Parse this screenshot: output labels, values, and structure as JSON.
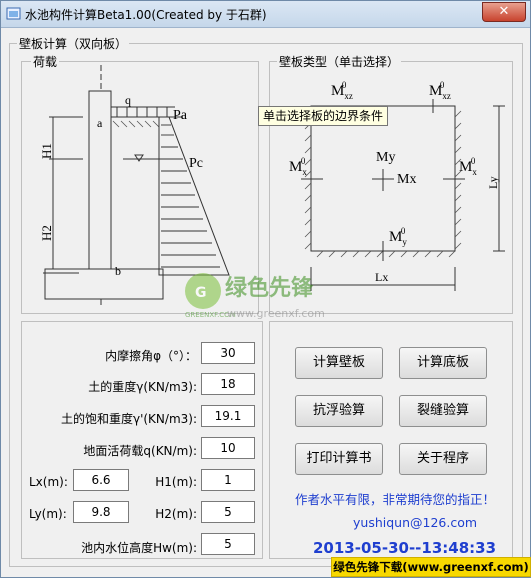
{
  "window": {
    "title": "水池构件计算Beta1.00(Created by 于石群)",
    "close_glyph": "✕"
  },
  "group_main": {
    "title": "壁板计算（双向板）"
  },
  "group_load": {
    "title": "荷载",
    "labels": {
      "q": "q",
      "a": "a",
      "b": "b",
      "Pa": "Pa",
      "Pc": "Pc",
      "H1": "H1",
      "H2": "H2"
    }
  },
  "group_type": {
    "title": "壁板类型（单击选择）",
    "labels": {
      "Mxz0_left": "M",
      "Mxz0_right": "M",
      "Mx0_left": "M",
      "Mx0_right": "M",
      "My": "My",
      "Mx": "Mx",
      "My0": "M",
      "Lx": "Lx",
      "Ly": "Ly",
      "sub_xz": "xz",
      "sub_x": "x",
      "sub_y": "y",
      "sup_0": "0"
    }
  },
  "tooltip": "单击选择板的边界条件",
  "inputs": {
    "phi": {
      "label": "内摩擦角φ（°）：",
      "value": "30"
    },
    "gamma": {
      "label": "土的重度γ(KN/m3):",
      "value": "18"
    },
    "gamma_sat": {
      "label": "土的饱和重度γ'(KN/m3):",
      "value": "19.1"
    },
    "q": {
      "label": "地面活荷载q(KN/m):",
      "value": "10"
    },
    "Lx": {
      "label": "Lx(m):",
      "value": "6.6"
    },
    "H1": {
      "label": "H1(m):",
      "value": "1"
    },
    "Ly": {
      "label": "Ly(m):",
      "value": "9.8"
    },
    "H2": {
      "label": "H2(m):",
      "value": "5"
    },
    "Hw": {
      "label": "池内水位高度Hw(m):",
      "value": "5"
    }
  },
  "buttons": {
    "calc_wall": "计算壁板",
    "calc_bottom": "计算底板",
    "anti_float": "抗浮验算",
    "crack": "裂缝验算",
    "print": "打印计算书",
    "about": "关于程序"
  },
  "notes": {
    "author_note": "作者水平有限，非常期待您的指正！",
    "email": "yushiqun@126.com",
    "datetime": "2013-05-30--13:48:33"
  },
  "watermark": {
    "logo_text": "绿色先锋",
    "logo_sub": "GREENXF.COM",
    "url": "www.greenxf.com",
    "bar": "绿色先锋下载(www.greenxf.com)"
  },
  "colors": {
    "accent_blue": "#1f3fcf",
    "hatch": "#555555"
  }
}
